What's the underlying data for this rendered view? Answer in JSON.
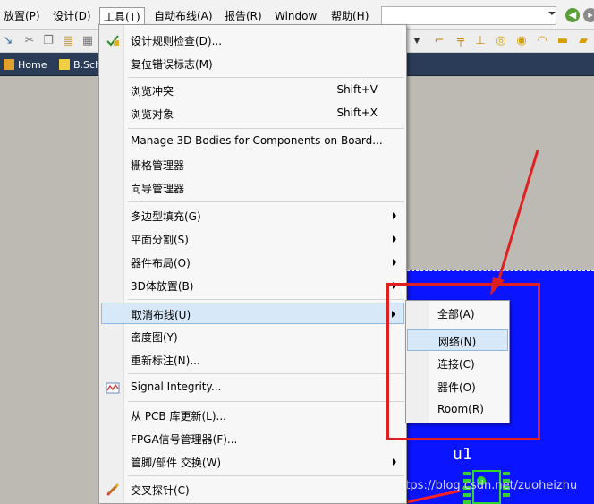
{
  "menubar": {
    "items": [
      "放置(P)",
      "设计(D)",
      "工具(T)",
      "自动布线(A)",
      "报告(R)",
      "Window",
      "帮助(H)"
    ]
  },
  "tabs": {
    "home": "Home",
    "schematic": "B.Sch"
  },
  "tools_menu": {
    "items": [
      {
        "label": "设计规则检查(D)..."
      },
      {
        "label": "复位错误标志(M)"
      },
      {
        "label": "浏览冲突",
        "shortcut": "Shift+V"
      },
      {
        "label": "浏览对象",
        "shortcut": "Shift+X"
      },
      {
        "label": "Manage 3D Bodies for Components on Board..."
      },
      {
        "label": "栅格管理器"
      },
      {
        "label": "向导管理器"
      },
      {
        "label": "多边型填充(G)"
      },
      {
        "label": "平面分割(S)"
      },
      {
        "label": "器件布局(O)"
      },
      {
        "label": "3D体放置(B)"
      },
      {
        "label": "取消布线(U)"
      },
      {
        "label": "密度图(Y)"
      },
      {
        "label": "重新标注(N)..."
      },
      {
        "label": "Signal Integrity..."
      },
      {
        "label": "从 PCB 库更新(L)..."
      },
      {
        "label": "FPGA信号管理器(F)..."
      },
      {
        "label": "管脚/部件 交换(W)"
      },
      {
        "label": "交叉探针(C)"
      }
    ]
  },
  "unroute_submenu": {
    "items": [
      "全部(A)",
      "网络(N)",
      "连接(C)",
      "器件(O)",
      "Room(R)"
    ]
  },
  "pcb": {
    "component_label": "u1"
  },
  "watermark": "https://blog.csdn.net/zuoheizhu",
  "colors": {
    "highlight": "#d7e8f8",
    "annotation_red": "#e02020",
    "pcb_background": "#0a14ff",
    "pad_green": "#34d233"
  }
}
